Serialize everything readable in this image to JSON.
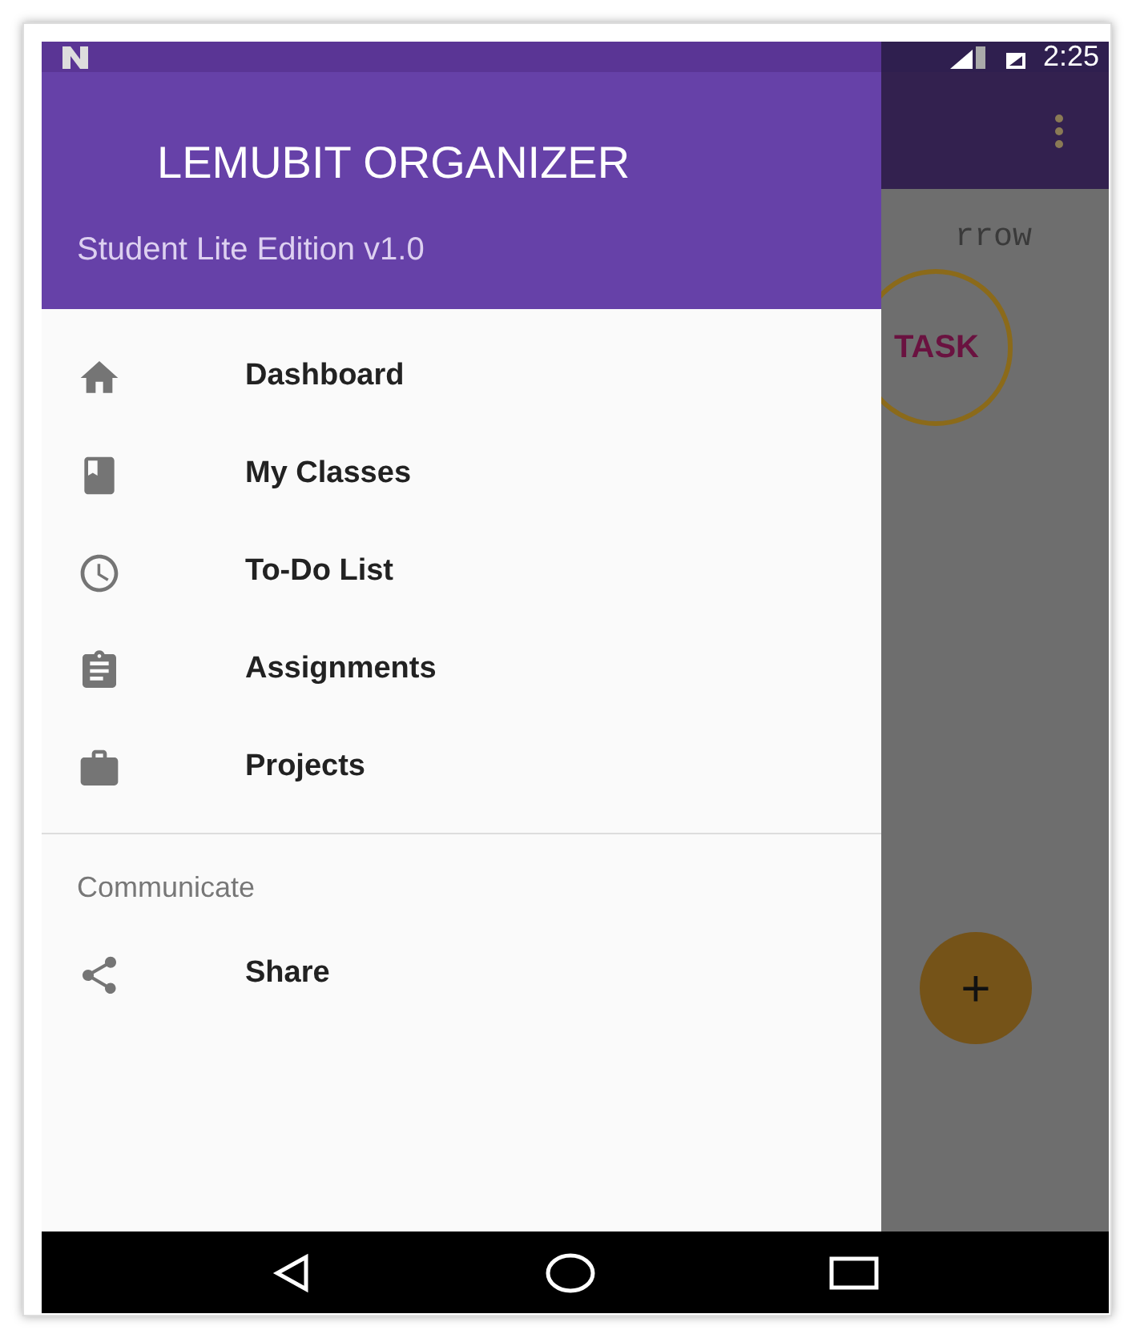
{
  "status_bar": {
    "time": "2:25"
  },
  "drawer": {
    "title": "LEMUBIT ORGANIZER",
    "subtitle": "Student Lite Edition v1.0",
    "items": [
      {
        "label": "Dashboard"
      },
      {
        "label": "My Classes"
      },
      {
        "label": "To-Do List"
      },
      {
        "label": "Assignments"
      },
      {
        "label": "Projects"
      }
    ],
    "section": {
      "heading": "Communicate",
      "items": [
        {
          "label": "Share"
        }
      ]
    }
  },
  "background": {
    "text": "rrow",
    "task_button": "TASK",
    "fab": "+"
  }
}
